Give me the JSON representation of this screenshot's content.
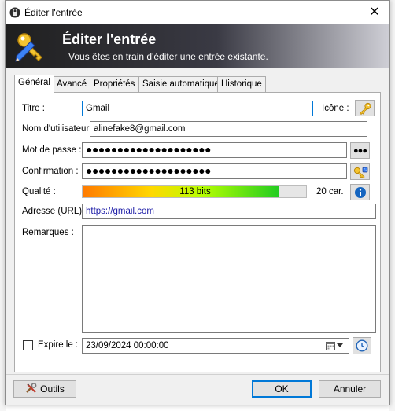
{
  "window": {
    "title": "Éditer l'entrée",
    "close_glyph": "✕"
  },
  "banner": {
    "title": "Éditer l'entrée",
    "subtitle": "Vous êtes en train d'éditer une entrée existante.",
    "icon": "key-pencil-icon"
  },
  "tabs": [
    {
      "label": "Général",
      "active": true
    },
    {
      "label": "Avancé",
      "active": false
    },
    {
      "label": "Propriétés",
      "active": false
    },
    {
      "label": "Saisie automatique",
      "active": false
    },
    {
      "label": "Historique",
      "active": false
    }
  ],
  "form": {
    "title_label": "Titre :",
    "title_value": "Gmail",
    "icon_label": "Icône :",
    "username_label": "Nom d'utilisateur :",
    "username_value": "alinefake8@gmail.com",
    "password_label": "Mot de passe :",
    "password_value": "●●●●●●●●●●●●●●●●●●●●",
    "reveal_button_label": "●●●",
    "confirm_label": "Confirmation :",
    "confirm_value": "●●●●●●●●●●●●●●●●●●●●",
    "quality_label": "Qualité :",
    "quality_text": "113 bits",
    "quality_fraction": 0.88,
    "char_count": "20 car.",
    "url_label": "Adresse (URL) :",
    "url_value": "https://gmail.com",
    "notes_label": "Remarques :",
    "notes_value": "",
    "expire_label": "Expire le :",
    "expire_checked": false,
    "expire_value": "23/09/2024 00:00:00"
  },
  "buttons": {
    "tools_label": "Outils",
    "ok_label": "OK",
    "cancel_label": "Annuler"
  },
  "colors": {
    "accent": "#0078d7",
    "url_text": "#1a1aa6",
    "info_blue": "#1565c0"
  }
}
